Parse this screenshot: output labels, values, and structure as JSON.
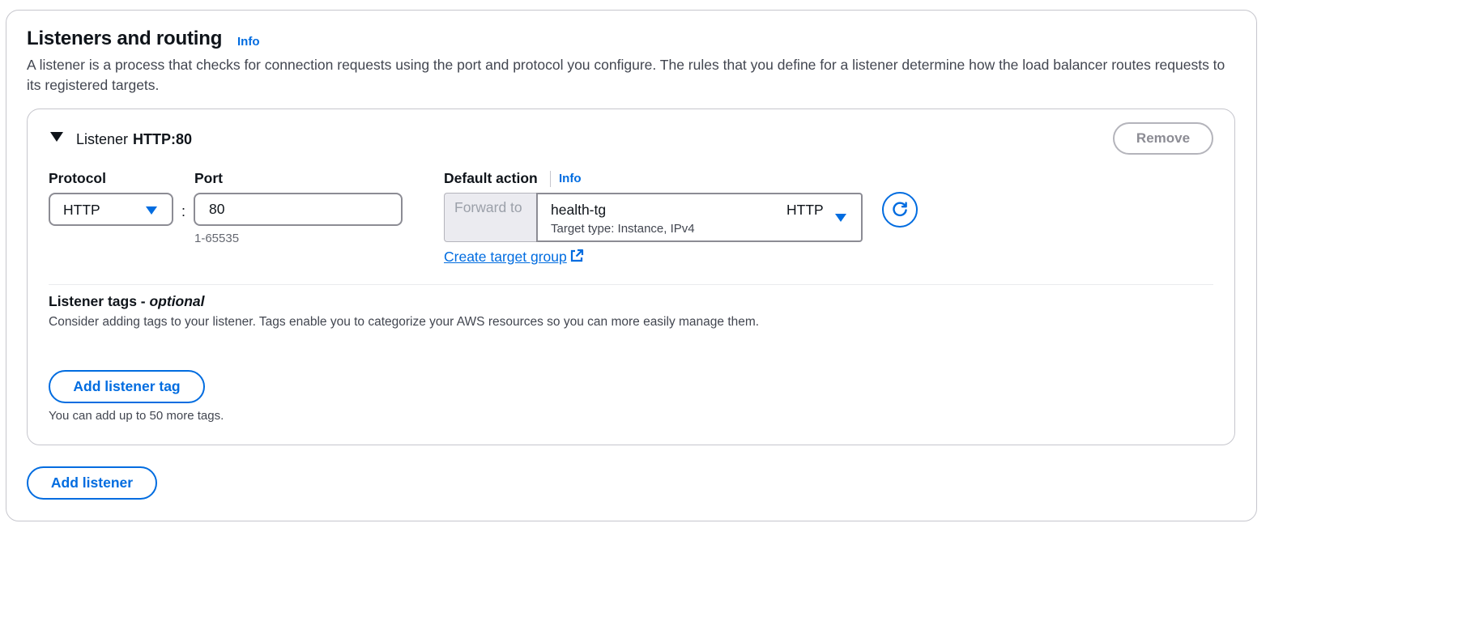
{
  "section": {
    "title": "Listeners and routing",
    "info_label": "Info",
    "description": "A listener is a process that checks for connection requests using the port and protocol you configure. The rules that you define for a listener determine how the load balancer routes requests to its registered targets."
  },
  "listener": {
    "label": "Listener",
    "name": "HTTP:80",
    "remove_label": "Remove",
    "protocol": {
      "label": "Protocol",
      "value": "HTTP"
    },
    "port": {
      "label": "Port",
      "value": "80",
      "constraint": "1-65535"
    },
    "default_action": {
      "label": "Default action",
      "info_label": "Info",
      "forward_label": "Forward to",
      "target_group_name": "health-tg",
      "target_group_protocol": "HTTP",
      "target_group_detail": "Target type: Instance, IPv4",
      "create_link": "Create target group"
    },
    "tags": {
      "title": "Listener tags - ",
      "title_optional": "optional",
      "description": "Consider adding tags to your listener. Tags enable you to categorize your AWS resources so you can more easily manage them.",
      "add_label": "Add listener tag",
      "hint": "You can add up to 50 more tags."
    }
  },
  "add_listener_label": "Add listener",
  "icons": {
    "expand": "caret-down-icon",
    "select": "dropdown-triangle-icon",
    "refresh": "refresh-icon",
    "external": "external-link-icon"
  },
  "colors": {
    "accent": "#006ce0",
    "text": "#0f141a",
    "secondary_text": "#424650",
    "border": "#8c8c94",
    "disabled_bg": "#ebebf0"
  }
}
